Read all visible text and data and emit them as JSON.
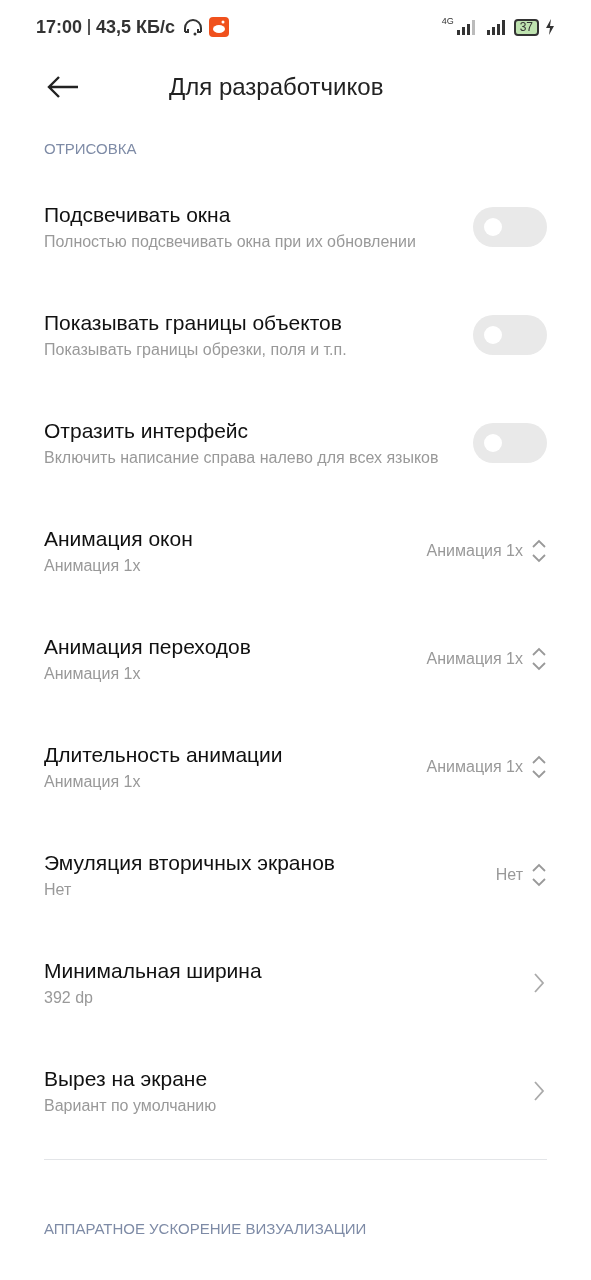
{
  "status_bar": {
    "time": "17:00",
    "speed": "43,5 КБ/с",
    "network": "4G",
    "battery": "37"
  },
  "header": {
    "title": "Для разработчиков"
  },
  "sections": [
    {
      "title": "ОТРИСОВКА",
      "items": [
        {
          "kind": "toggle",
          "title": "Подсвечивать окна",
          "subtitle": "Полностью подсвечивать окна при их обновлении",
          "on": false
        },
        {
          "kind": "toggle",
          "title": "Показывать границы объектов",
          "subtitle": "Показывать границы обрезки, поля и т.п.",
          "on": false
        },
        {
          "kind": "toggle",
          "title": "Отразить интерфейс",
          "subtitle": "Включить написание справа налево для всех языков",
          "on": false
        },
        {
          "kind": "select",
          "title": "Анимация окон",
          "subtitle": "Анимация 1x",
          "value": "Анимация 1x"
        },
        {
          "kind": "select",
          "title": "Анимация переходов",
          "subtitle": "Анимация 1x",
          "value": "Анимация 1x"
        },
        {
          "kind": "select",
          "title": "Длительность анимации",
          "subtitle": "Анимация 1x",
          "value": "Анимация 1x"
        },
        {
          "kind": "select",
          "title": "Эмуляция вторичных экранов",
          "subtitle": "Нет",
          "value": "Нет"
        },
        {
          "kind": "link",
          "title": "Минимальная ширина",
          "subtitle": "392 dp"
        },
        {
          "kind": "link",
          "title": "Вырез на экране",
          "subtitle": "Вариант по умолчанию"
        }
      ]
    },
    {
      "title": "АППАРАТНОЕ УСКОРЕНИЕ ВИЗУАЛИЗАЦИИ"
    }
  ]
}
